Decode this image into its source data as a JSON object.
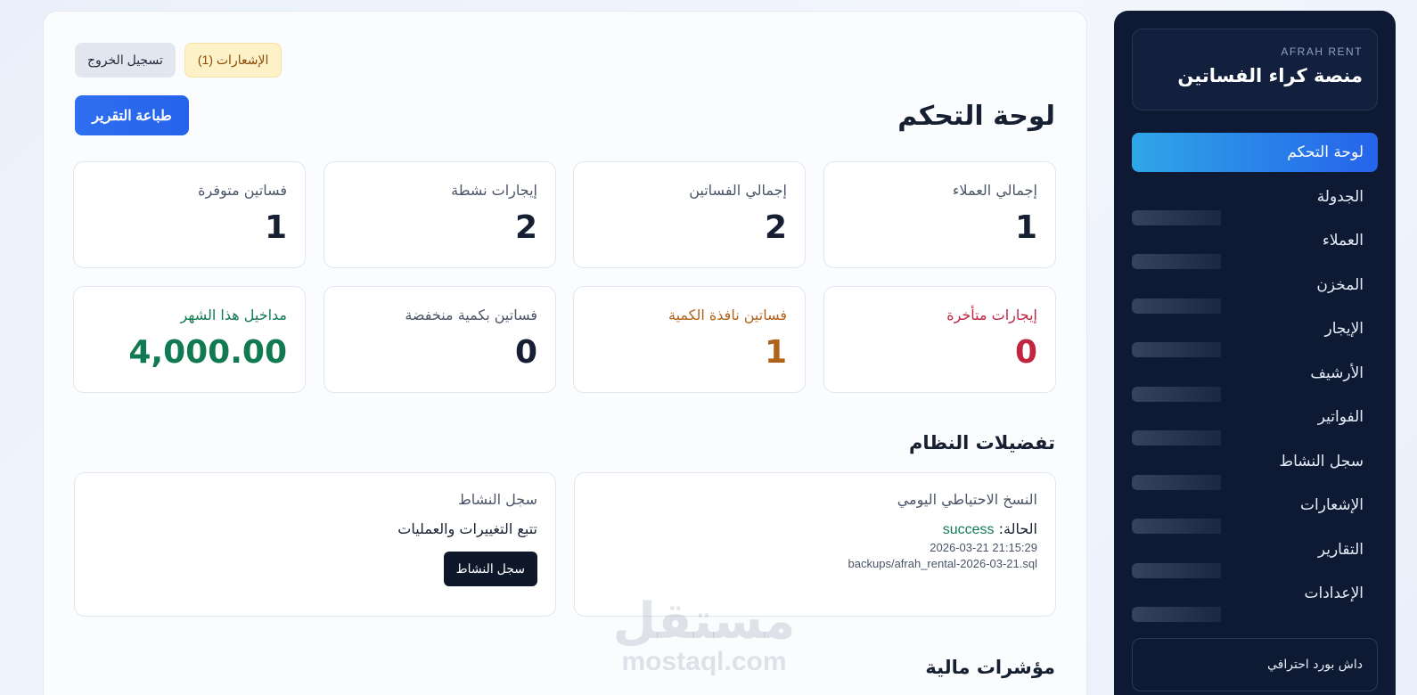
{
  "sidebar": {
    "brand_tag": "AFRAH RENT",
    "brand_title": "منصة كراء الفساتين",
    "items": [
      {
        "label": "لوحة التحكم"
      },
      {
        "label": "الجدولة"
      },
      {
        "label": "العملاء"
      },
      {
        "label": "المخزن"
      },
      {
        "label": "الإيجار"
      },
      {
        "label": "الأرشيف"
      },
      {
        "label": "الفواتير"
      },
      {
        "label": "سجل النشاط"
      },
      {
        "label": "الإشعارات"
      },
      {
        "label": "التقارير"
      },
      {
        "label": "الإعدادات"
      }
    ],
    "footer": "داش بورد احترافي"
  },
  "header": {
    "logout_label": "تسجيل الخروج",
    "notifications_label": "الإشعارات (1)",
    "print_label": "طباعة التقرير",
    "title": "لوحة التحكم"
  },
  "stats": [
    {
      "label": "إجمالي العملاء",
      "value": "1"
    },
    {
      "label": "إجمالي الفساتين",
      "value": "2"
    },
    {
      "label": "إيجارات نشطة",
      "value": "2"
    },
    {
      "label": "فساتين متوفرة",
      "value": "1"
    },
    {
      "label": "إيجارات متأخرة",
      "value": "0"
    },
    {
      "label": "فساتين نافذة الكمية",
      "value": "1"
    },
    {
      "label": "فساتين بكمية منخفضة",
      "value": "0"
    },
    {
      "label": "مداخيل هذا الشهر",
      "value": "4,000.00"
    }
  ],
  "preferences": {
    "title": "تفضيلات النظام",
    "backup": {
      "label": "النسخ الاحتياطي اليومي",
      "status_prefix": "الحالة:",
      "status_value": "success",
      "timestamp": "2026-03-21 21:15:29",
      "path": "backups/afrah_rental-2026-03-21.sql"
    },
    "activity": {
      "label": "سجل النشاط",
      "description": "تتبع التغييرات والعمليات",
      "button": "سجل النشاط"
    }
  },
  "financial_title": "مؤشرات مالية",
  "watermark": {
    "arabic": "مستقل",
    "latin": "mostaql.com"
  },
  "colors": {
    "accent": "#2563eb",
    "sidebar_bg": "#0e1a33",
    "danger": "#c0263f",
    "warning": "#b1621a",
    "success": "#127a52"
  }
}
